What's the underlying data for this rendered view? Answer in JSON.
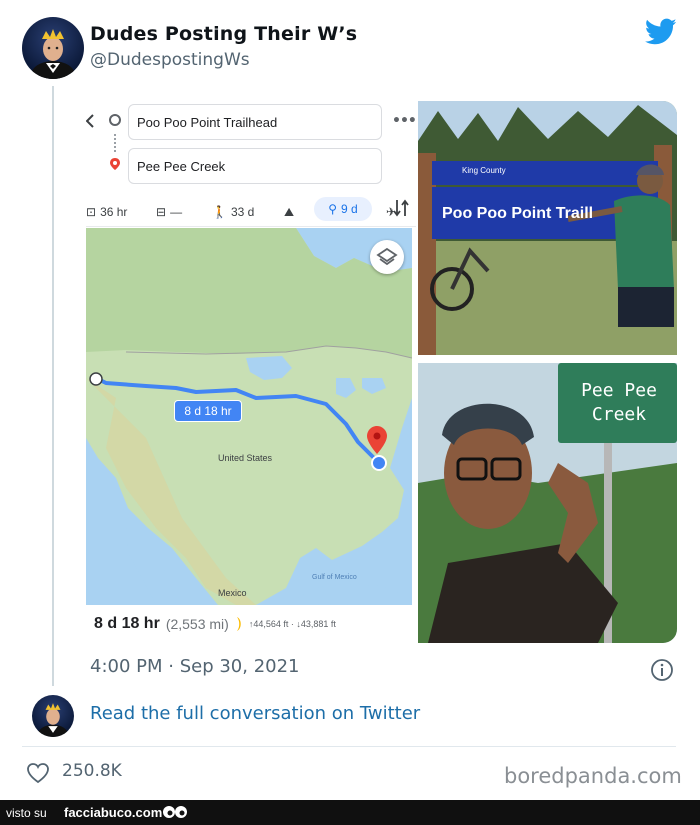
{
  "tweet": {
    "display_name": "Dudes Posting Their W’s",
    "handle": "@DudespostingWs",
    "timestamp": "4:00 PM · Sep 30, 2021",
    "read_more": "Read the full conversation on Twitter",
    "likes": "250.8K"
  },
  "map": {
    "origin": "Poo Poo Point Trailhead",
    "destination": "Pee Pee Creek",
    "modes": [
      {
        "icon": "car-icon",
        "label": "36 hr"
      },
      {
        "icon": "transit-icon",
        "label": "—"
      },
      {
        "icon": "walk-icon",
        "label": "33 d"
      },
      {
        "icon": "hike-icon",
        "label": ""
      },
      {
        "icon": "bike-icon",
        "label": "9 d"
      },
      {
        "icon": "plane-icon",
        "label": ""
      }
    ],
    "route_duration_tag": "8 d 18 hr",
    "label_country": "United States",
    "label_mexico": "Mexico",
    "label_gulf": "Gulf of Mexico",
    "summary_duration": "8 d 18 hr",
    "summary_distance": "(2,553 mi)",
    "summary_elevation": "↑44,564 ft · ↓43,881 ft"
  },
  "photos": {
    "sign1_org": "King County",
    "sign1_text": "Poo Poo Point Traill",
    "sign2_text": "Pee Pee\nCreek"
  },
  "footer": {
    "visto": "visto su",
    "brand": "facciabuco.com"
  },
  "watermark": "boredpanda.com",
  "colors": {
    "link": "#1d6ea8",
    "twitter_blue": "#1d9bf0",
    "route_blue": "#4285f4",
    "sign_blue": "#1f3aa8",
    "sign_green": "#2f7d5a"
  }
}
